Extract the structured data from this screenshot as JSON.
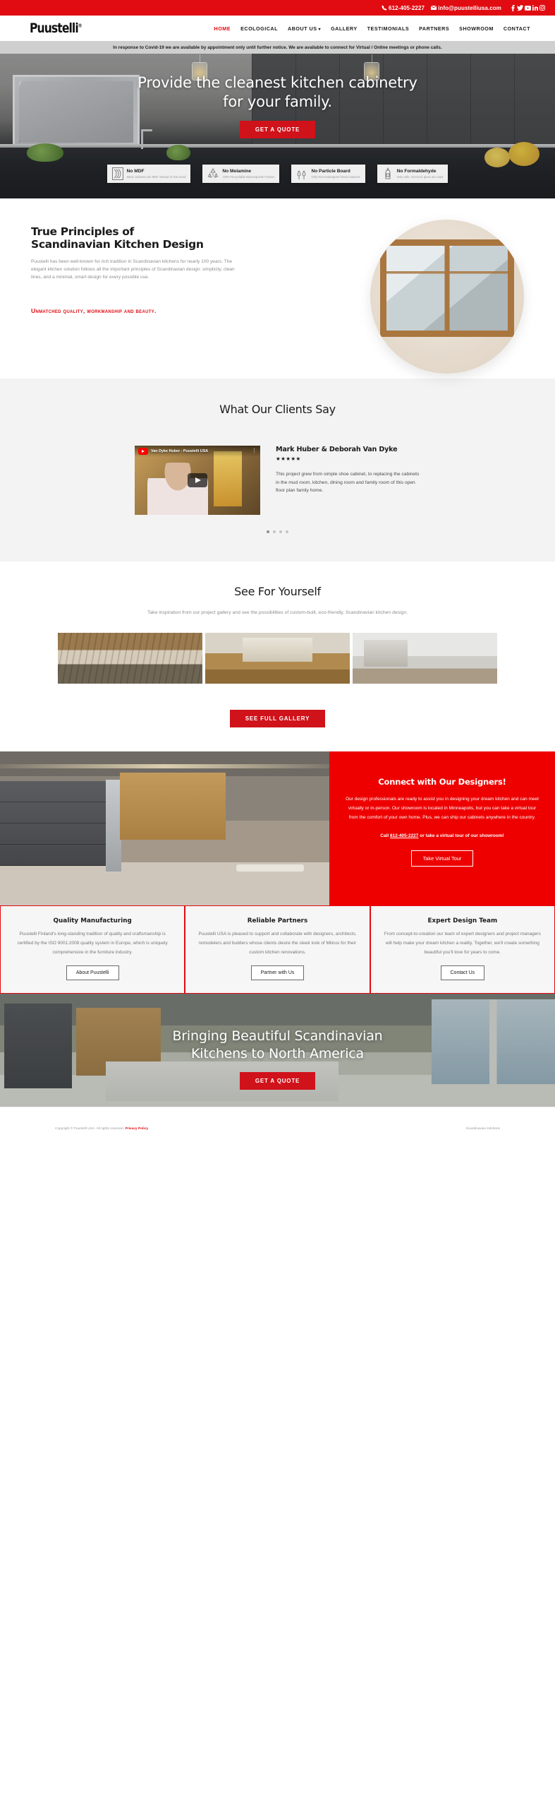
{
  "topbar": {
    "phone": "612-405-2227",
    "email": "info@puustelliusa.com",
    "social": [
      "facebook-icon",
      "twitter-icon",
      "youtube-icon",
      "linkedin-icon",
      "instagram-icon"
    ]
  },
  "nav": {
    "logo": "Puustelli",
    "logo_mark": "®",
    "items": [
      {
        "label": "HOME",
        "active": true
      },
      {
        "label": "ECOLOGICAL",
        "active": false
      },
      {
        "label": "ABOUT US",
        "active": false,
        "caret": "⌄"
      },
      {
        "label": "GALLERY",
        "active": false
      },
      {
        "label": "TESTIMONIALS",
        "active": false
      },
      {
        "label": "PARTNERS",
        "active": false
      },
      {
        "label": "SHOWROOM",
        "active": false
      },
      {
        "label": "CONTACT",
        "active": false
      }
    ]
  },
  "notice": {
    "text": "In response to Covid-19 we are available by appointment only until further notice. We are available to connect for Virtual / Online meetings or phone calls."
  },
  "hero": {
    "heading": "Provide the cleanest kitchen cabinetry for your family.",
    "cta": "GET A QUOTE",
    "badges": [
      {
        "title": "No MDF",
        "sub": "Many cabinets use MDF instead of real wood",
        "icon": "wood-grain-icon"
      },
      {
        "title": "No Melamine",
        "sub": "100% Recyclable Biocomposite Frames",
        "icon": "recycle-5-icon"
      },
      {
        "title": "No Particle Board",
        "sub": "Only Non-endangered Wood Species",
        "icon": "forest-trees-icon"
      },
      {
        "title": "No Formaldehyde",
        "sub": "Only safe, non-toxic glues are used",
        "icon": "glue-bottle-icon"
      }
    ]
  },
  "principles": {
    "heading_line1": "True Principles of",
    "heading_line2": "Scandinavian Kitchen Design",
    "body": "Puustelli has been well-known for rich tradition in Scandinavian kitchens for nearly 100 years. The elegant kitchen solution follows all the important principles of Scandinavian design: simplicity, clean lines, and a minimal, smart design for every possible use.",
    "tagline": "Unmatched quality, workmanship and beauty."
  },
  "clients": {
    "title": "What Our Clients Say",
    "video": {
      "title": "Van Dyke Huber - Puustelli USA",
      "brand": "youtube-logo-icon",
      "menu": "⋮"
    },
    "name": "Mark Huber & Deborah Van Dyke",
    "stars": "★★★★★",
    "quote": "This project grew from simple shoe cabinet, to replacing the cabinets in the mud room, kitchen, dining room and family room of this open floor plan family home.",
    "slides": 4,
    "active_slide": 1
  },
  "gallery": {
    "title": "See For Yourself",
    "subtitle": "Take inspiration from our project gallery and see the possibilities of custom-built, eco-friendly, Scandinavian kitchen design.",
    "cta": "SEE FULL GALLERY",
    "images": [
      "gallery-image-wood-ceiling",
      "gallery-image-kitchen-range",
      "gallery-image-white-kitchen"
    ]
  },
  "designers": {
    "heading": "Connect with Our Designers!",
    "body": "Our design professionals are ready to assist you in designing your dream kitchen and can meet virtually or in-person. Our showroom is located in Minneapolis, but you can take a virtual tour from the comfort of your own home.  Plus, we can ship our cabinets anywhere in the country.",
    "call_prefix": "Call ",
    "call_phone": "612-405-2227",
    "call_suffix": " or take a virtual tour of our showroom!",
    "cta": "Take Virtual Tour"
  },
  "boxes": [
    {
      "title": "Quality Manufacturing",
      "body": "Puustelli Finland's long-standing tradition of quality and craftsmanship is certified by the ISO 9001:2008 quality system in Europe, which is uniquely comprehensive in the furniture industry.",
      "cta": "About Puustelli"
    },
    {
      "title": "Reliable Partners",
      "body": "Puustelli USA is pleased to support and collaborate with designers, architects, remodelers and builders whose clients desire the sleek look of Miinus for their custom kitchen renovations.",
      "cta": "Partner with Us"
    },
    {
      "title": "Expert Design Team",
      "body": "From concept-to-creation our team of expert designers and project managers will help make your dream kitchen a reality. Together, we'll create something beautiful you'll love for years to come.",
      "cta": "Contact Us"
    }
  ],
  "bottom": {
    "heading_line1": "Bringing Beautiful Scandinavian",
    "heading_line2": "Kitchens to North America",
    "cta": "GET A QUOTE"
  },
  "footer": {
    "copyright": "Copyright © Puustelli USA. All rights reserved.",
    "privacy": "Privacy Policy",
    "right": "Scandinavian Kitchens"
  },
  "colors": {
    "brand_red": "#e10b12",
    "panel_red": "#ee0000",
    "notice_gray": "#cfcfcf"
  }
}
